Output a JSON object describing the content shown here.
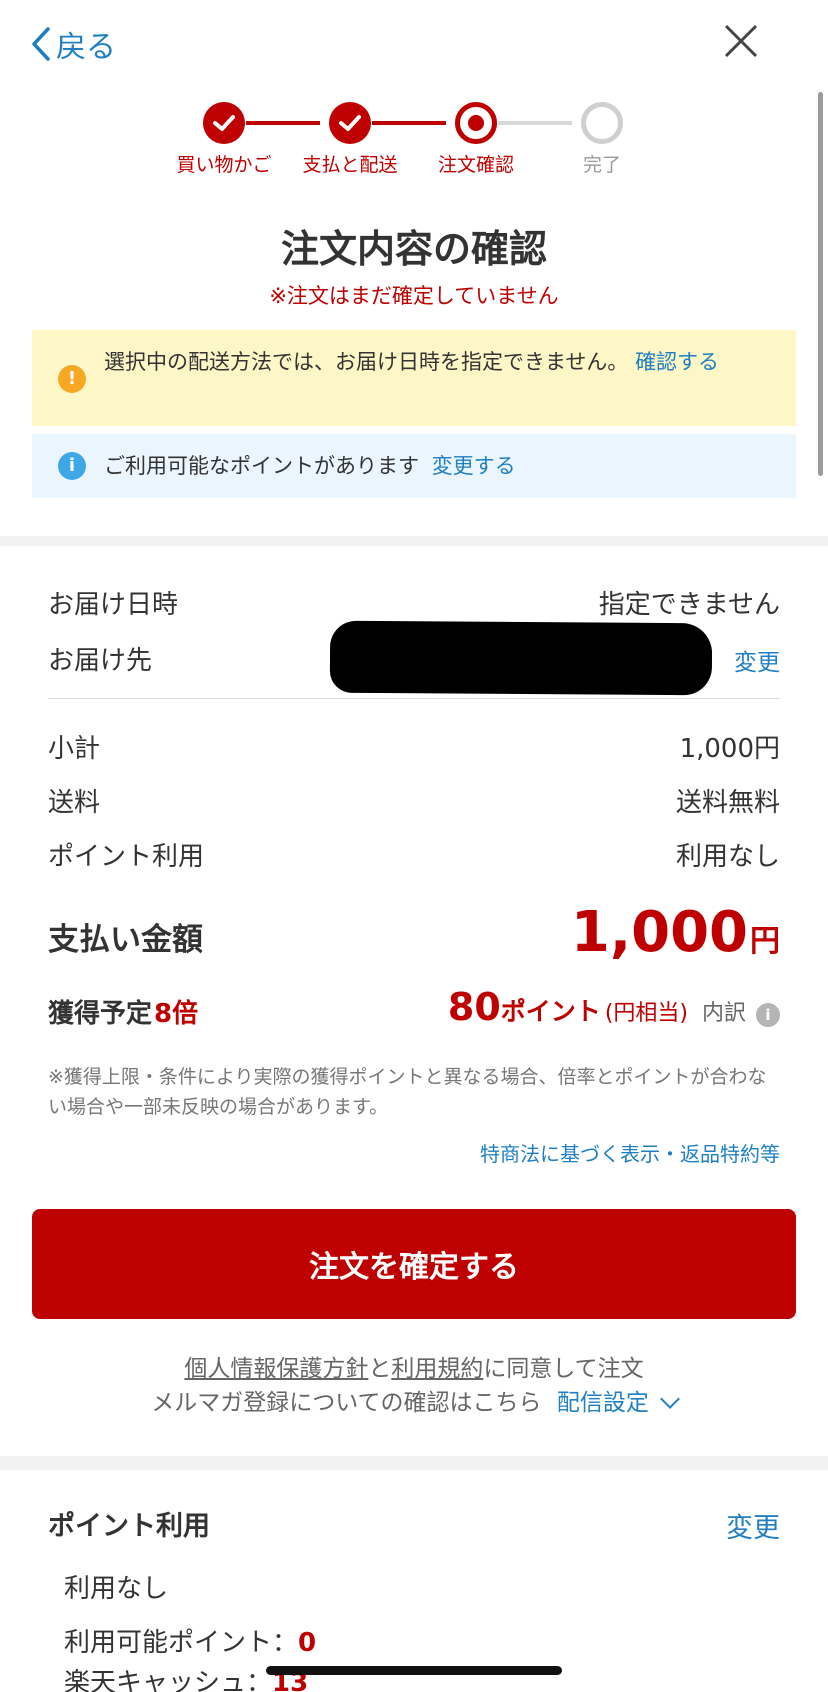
{
  "nav": {
    "back_label": "戻る"
  },
  "steps": [
    {
      "label": "買い物かご",
      "state": "done"
    },
    {
      "label": "支払と配送",
      "state": "done"
    },
    {
      "label": "注文確認",
      "state": "current"
    },
    {
      "label": "完了",
      "state": "todo"
    }
  ],
  "header": {
    "title": "注文内容の確認",
    "subtitle": "※注文はまだ確定していません"
  },
  "notices": {
    "warning_text": "選択中の配送方法では、お届け日時を指定できません。",
    "warning_link": "確認する",
    "info_text": "ご利用可能なポイントがあります",
    "info_link": "変更する"
  },
  "delivery": {
    "date_label": "お届け日時",
    "date_value": "指定できません",
    "address_label": "お届け先",
    "address_ellipsis": "・・",
    "address_change": "変更"
  },
  "summary": {
    "subtotal_label": "小計",
    "subtotal_value": "1,000円",
    "shipping_label": "送料",
    "shipping_value": "送料無料",
    "points_label": "ポイント利用",
    "points_value": "利用なし"
  },
  "payment": {
    "label": "支払い金額",
    "amount": "1,000",
    "currency": "円"
  },
  "earn": {
    "label": "獲得予定",
    "multiplier": "8倍",
    "points": "80",
    "points_unit": "ポイント",
    "equiv": "(円相当)",
    "breakdown": "内訳",
    "info_icon": "i"
  },
  "note": "※獲得上限・条件により実際の獲得ポイントと異なる場合、倍率とポイントが合わない場合や一部未反映の場合があります。",
  "legal_link": "特商法に基づく表示・返品特約等",
  "confirm_button": "注文を確定する",
  "agreement": {
    "privacy": "個人情報保護方針",
    "and": "と",
    "terms": "利用規約",
    "suffix": "に同意して注文",
    "mailmag": "メルマガ登録についての確認はこちら",
    "delivery_settings": "配信設定"
  },
  "point_section": {
    "title": "ポイント利用",
    "change": "変更",
    "status": "利用なし",
    "available_label": "利用可能ポイント：",
    "available_value": "0",
    "cash_label": "楽天キャッシュ：",
    "cash_value": "13"
  },
  "colors": {
    "brand_red": "#bf0000",
    "link_blue": "#1f7fc2",
    "warning_bg": "#fdf6c6",
    "info_bg": "#eaf5fd"
  },
  "icons": {
    "back": "chevron-left-icon",
    "close": "close-icon",
    "warning": "warning-circle-icon",
    "info": "info-circle-icon"
  }
}
